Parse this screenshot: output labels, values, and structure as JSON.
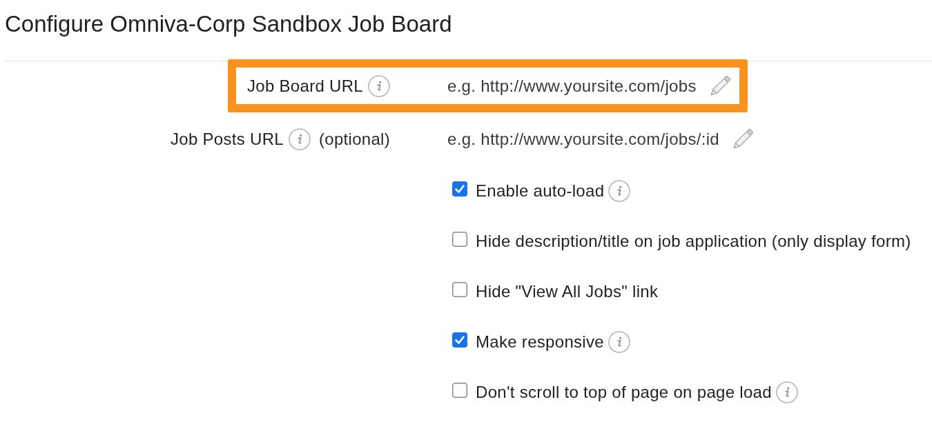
{
  "page_title": "Configure Omniva-Corp Sandbox Job Board",
  "url_fields": [
    {
      "label": "Job Board URL",
      "info": true,
      "placeholder": "e.g. http://www.yoursite.com/jobs",
      "highlighted": true
    },
    {
      "label": "Job Posts URL",
      "info": true,
      "note": "(optional)",
      "placeholder": "e.g. http://www.yoursite.com/jobs/:id",
      "highlighted": false
    }
  ],
  "options": [
    {
      "label": "Enable auto-load",
      "checked": true,
      "info": true
    },
    {
      "label": "Hide description/title on job application (only display form)",
      "checked": false,
      "info": false
    },
    {
      "label": "Hide \"View All Jobs\" link",
      "checked": false,
      "info": false
    },
    {
      "label": "Make responsive",
      "checked": true,
      "info": true
    },
    {
      "label": "Don't scroll to top of page on page load",
      "checked": false,
      "info": true
    }
  ]
}
